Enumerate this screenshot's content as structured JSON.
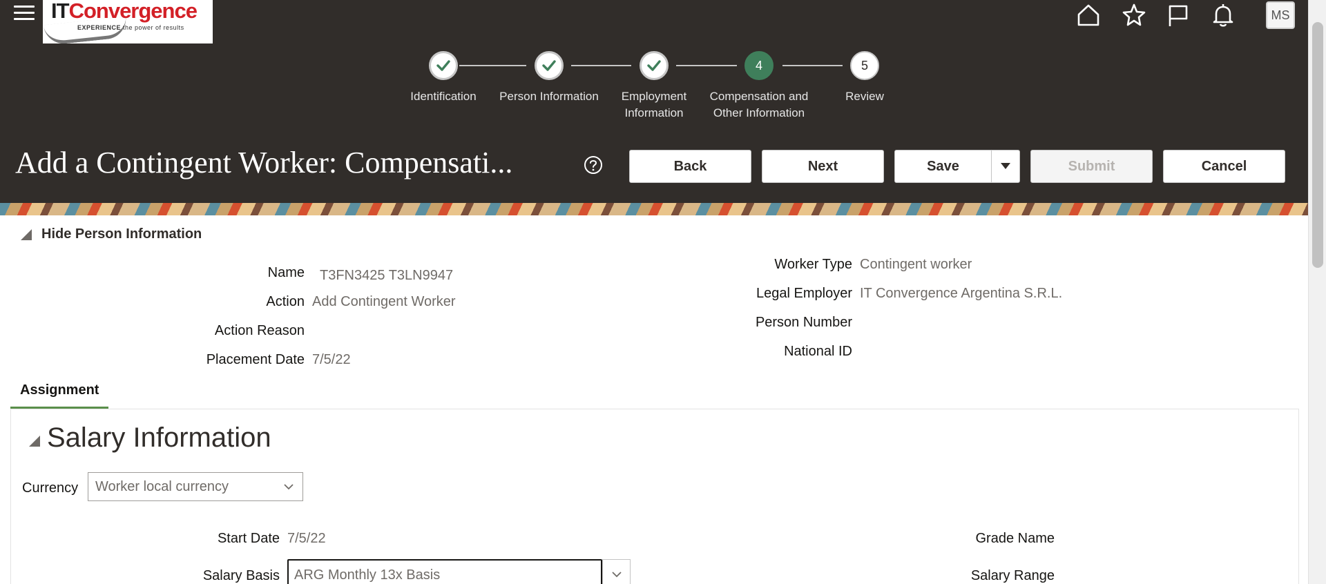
{
  "header": {
    "logo": {
      "it": "IT",
      "convergence": "Convergence",
      "tagline_bold": "EXPERIENCE",
      "tagline_rest": " the power of results"
    },
    "icons": [
      "home-icon",
      "favorites-icon",
      "watchlist-flag-icon",
      "notifications-bell-icon"
    ],
    "avatar_initials": "MS"
  },
  "train": {
    "steps": [
      {
        "label": "Identification",
        "state": "done"
      },
      {
        "label": "Person Information",
        "state": "done"
      },
      {
        "label": "Employment Information",
        "state": "done"
      },
      {
        "label": "Compensation and Other Information",
        "state": "current",
        "number": "4"
      },
      {
        "label": "Review",
        "state": "future",
        "number": "5"
      }
    ]
  },
  "page": {
    "title": "Add a Contingent Worker: Compensati...",
    "buttons": {
      "back": "Back",
      "next": "Next",
      "save": "Save",
      "submit": "Submit",
      "cancel": "Cancel"
    }
  },
  "person_info": {
    "toggle_label": "Hide Person Information",
    "left": [
      {
        "label": "Name",
        "value": "T3FN3425 T3LN9947"
      },
      {
        "label": "Action",
        "value": "Add Contingent Worker"
      },
      {
        "label": "Action Reason",
        "value": ""
      },
      {
        "label": "Placement Date",
        "value": "7/5/22"
      }
    ],
    "right": [
      {
        "label": "Worker Type",
        "value": "Contingent worker"
      },
      {
        "label": "Legal Employer",
        "value": "IT Convergence Argentina S.R.L."
      },
      {
        "label": "Person Number",
        "value": ""
      },
      {
        "label": "National ID",
        "value": ""
      }
    ]
  },
  "tabs": [
    {
      "label": "Assignment",
      "active": true
    }
  ],
  "salary": {
    "section_title": "Salary Information",
    "currency_label": "Currency",
    "currency_value": "Worker local currency",
    "start_date_label": "Start Date",
    "start_date_value": "7/5/22",
    "salary_basis_label": "Salary Basis",
    "salary_basis_value": "ARG Monthly 13x Basis",
    "grade_name_label": "Grade Name",
    "salary_range_label": "Salary Range"
  },
  "colors": {
    "header_bg": "#312d2a",
    "step_current": "#3f7f5b",
    "check": "#3f7f5b",
    "tab_underline": "#5a8f4a"
  }
}
